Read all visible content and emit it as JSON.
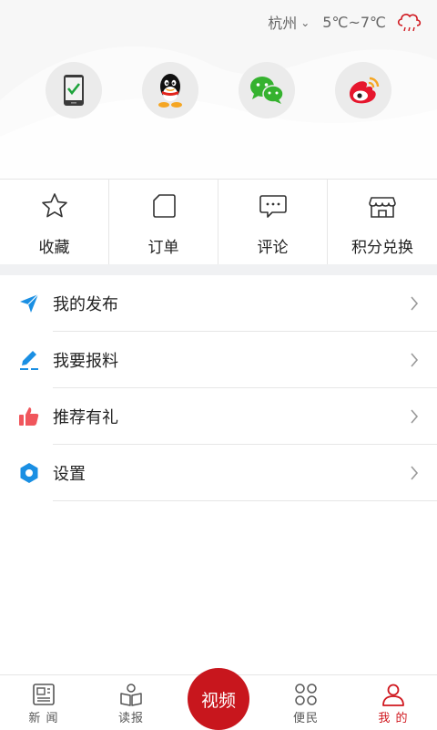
{
  "header": {
    "city": "杭州",
    "temperature": "5℃~7℃"
  },
  "login_icons": [
    "phone-login-icon",
    "qq-icon",
    "wechat-icon",
    "weibo-icon"
  ],
  "quick_actions": [
    {
      "label": "收藏",
      "icon": "star-icon"
    },
    {
      "label": "订单",
      "icon": "order-icon"
    },
    {
      "label": "评论",
      "icon": "comment-icon"
    },
    {
      "label": "积分兑换",
      "icon": "store-icon"
    }
  ],
  "menu": [
    {
      "label": "我的发布",
      "icon": "send-icon"
    },
    {
      "label": "我要报料",
      "icon": "pen-icon"
    },
    {
      "label": "推荐有礼",
      "icon": "thumb-icon"
    },
    {
      "label": "设置",
      "icon": "settings-icon"
    }
  ],
  "tabbar": {
    "news": "新 闻",
    "read": "读报",
    "video": "视频",
    "service": "便民",
    "mine": "我 的"
  },
  "colors": {
    "brand_red": "#c8161d",
    "accent_blue": "#1a8fe3",
    "thumb_red": "#f0565c"
  }
}
